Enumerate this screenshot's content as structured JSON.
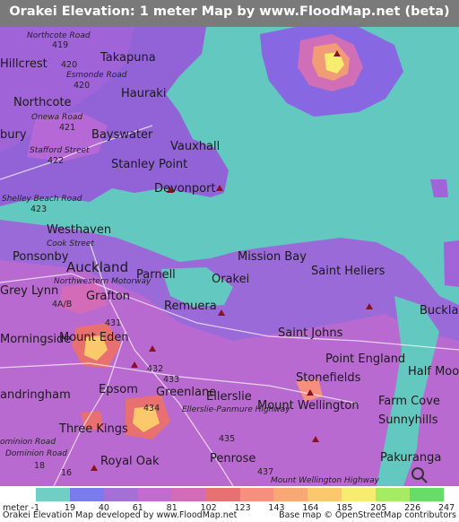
{
  "title": "Orakei Elevation: 1 meter Map by www.FloodMap.net (beta)",
  "labels": {
    "northcote_road": "Northcote Road",
    "r419": "419",
    "takapuna": "Takapuna",
    "hillcrest": "Hillcrest",
    "esmonde_road": "Esmonde Road",
    "r420": "420",
    "hauraki": "Hauraki",
    "northcote": "Northcote",
    "onewa_road": "Onewa Road",
    "r421": "421",
    "bury": "bury",
    "bayswater": "Bayswater",
    "stafford_street": "Stafford Street",
    "vauxhall": "Vauxhall",
    "r422": "422",
    "stanley_point": "Stanley Point",
    "devonport": "Devonport",
    "shelley_beach_road": "Shelley Beach Road",
    "r423": "423",
    "westhaven": "Westhaven",
    "cook_street": "Cook Street",
    "ponsonby": "Ponsonby",
    "auckland": "Auckland",
    "parnell": "Parnell",
    "mission_bay": "Mission Bay",
    "saint_heliers": "Saint Heliers",
    "grey_lynn": "Grey Lynn",
    "northwestern_motorway": "Northwestern Motorway",
    "orakei": "Orakei",
    "grafton": "Grafton",
    "r4ab": "4A/B",
    "r431": "431",
    "bucklands": "Bucklan",
    "morningside": "Morningside",
    "mount_eden": "Mount Eden",
    "remuera": "Remuera",
    "saint_johns": "Saint Johns",
    "r432": "432",
    "point_england": "Point England",
    "r433": "433",
    "half_moon": "Half Moon",
    "andringham": "andringham",
    "epsom": "Epsom",
    "greenlane": "Greenlane",
    "stonefields": "Stonefields",
    "mount_wellington": "Mount Wellington",
    "farm_cove": "Farm Cove",
    "r434": "434",
    "ellerslie": "Ellerslie",
    "sunnyhills": "Sunnyhills",
    "three_kings": "Three Kings",
    "ellerslie_panmure": "Ellerslie-Panmure Highway",
    "dominion_road_1": "ominion Road",
    "r435": "435",
    "dominion_road_2": "Dominion Road",
    "royal_oak": "Royal Oak",
    "penrose": "Penrose",
    "pakuranga": "Pakuranga",
    "r18": "18",
    "r437": "437",
    "r16": "16",
    "mount_wellington_hwy": "Mount Wellington Highway"
  },
  "legend": {
    "unit_label": "meter",
    "values": [
      "-1",
      "19",
      "40",
      "61",
      "81",
      "102",
      "123",
      "143",
      "164",
      "185",
      "205",
      "226",
      "247"
    ],
    "colors": [
      "#6fcfc5",
      "#7b7bf0",
      "#a56fd8",
      "#c36bd0",
      "#d36bb8",
      "#e97070",
      "#f78e7e",
      "#f9a874",
      "#fbc86c",
      "#f6ec6e",
      "#a6ec63",
      "#66dd66"
    ]
  },
  "footer": {
    "left": "Orakei Elevation Map developed by www.FloodMap.net",
    "right": "Base map © OpenStreetMap contributors"
  },
  "icons": [
    "mountain-peak-icon",
    "openstreetmap-logo-icon"
  ]
}
